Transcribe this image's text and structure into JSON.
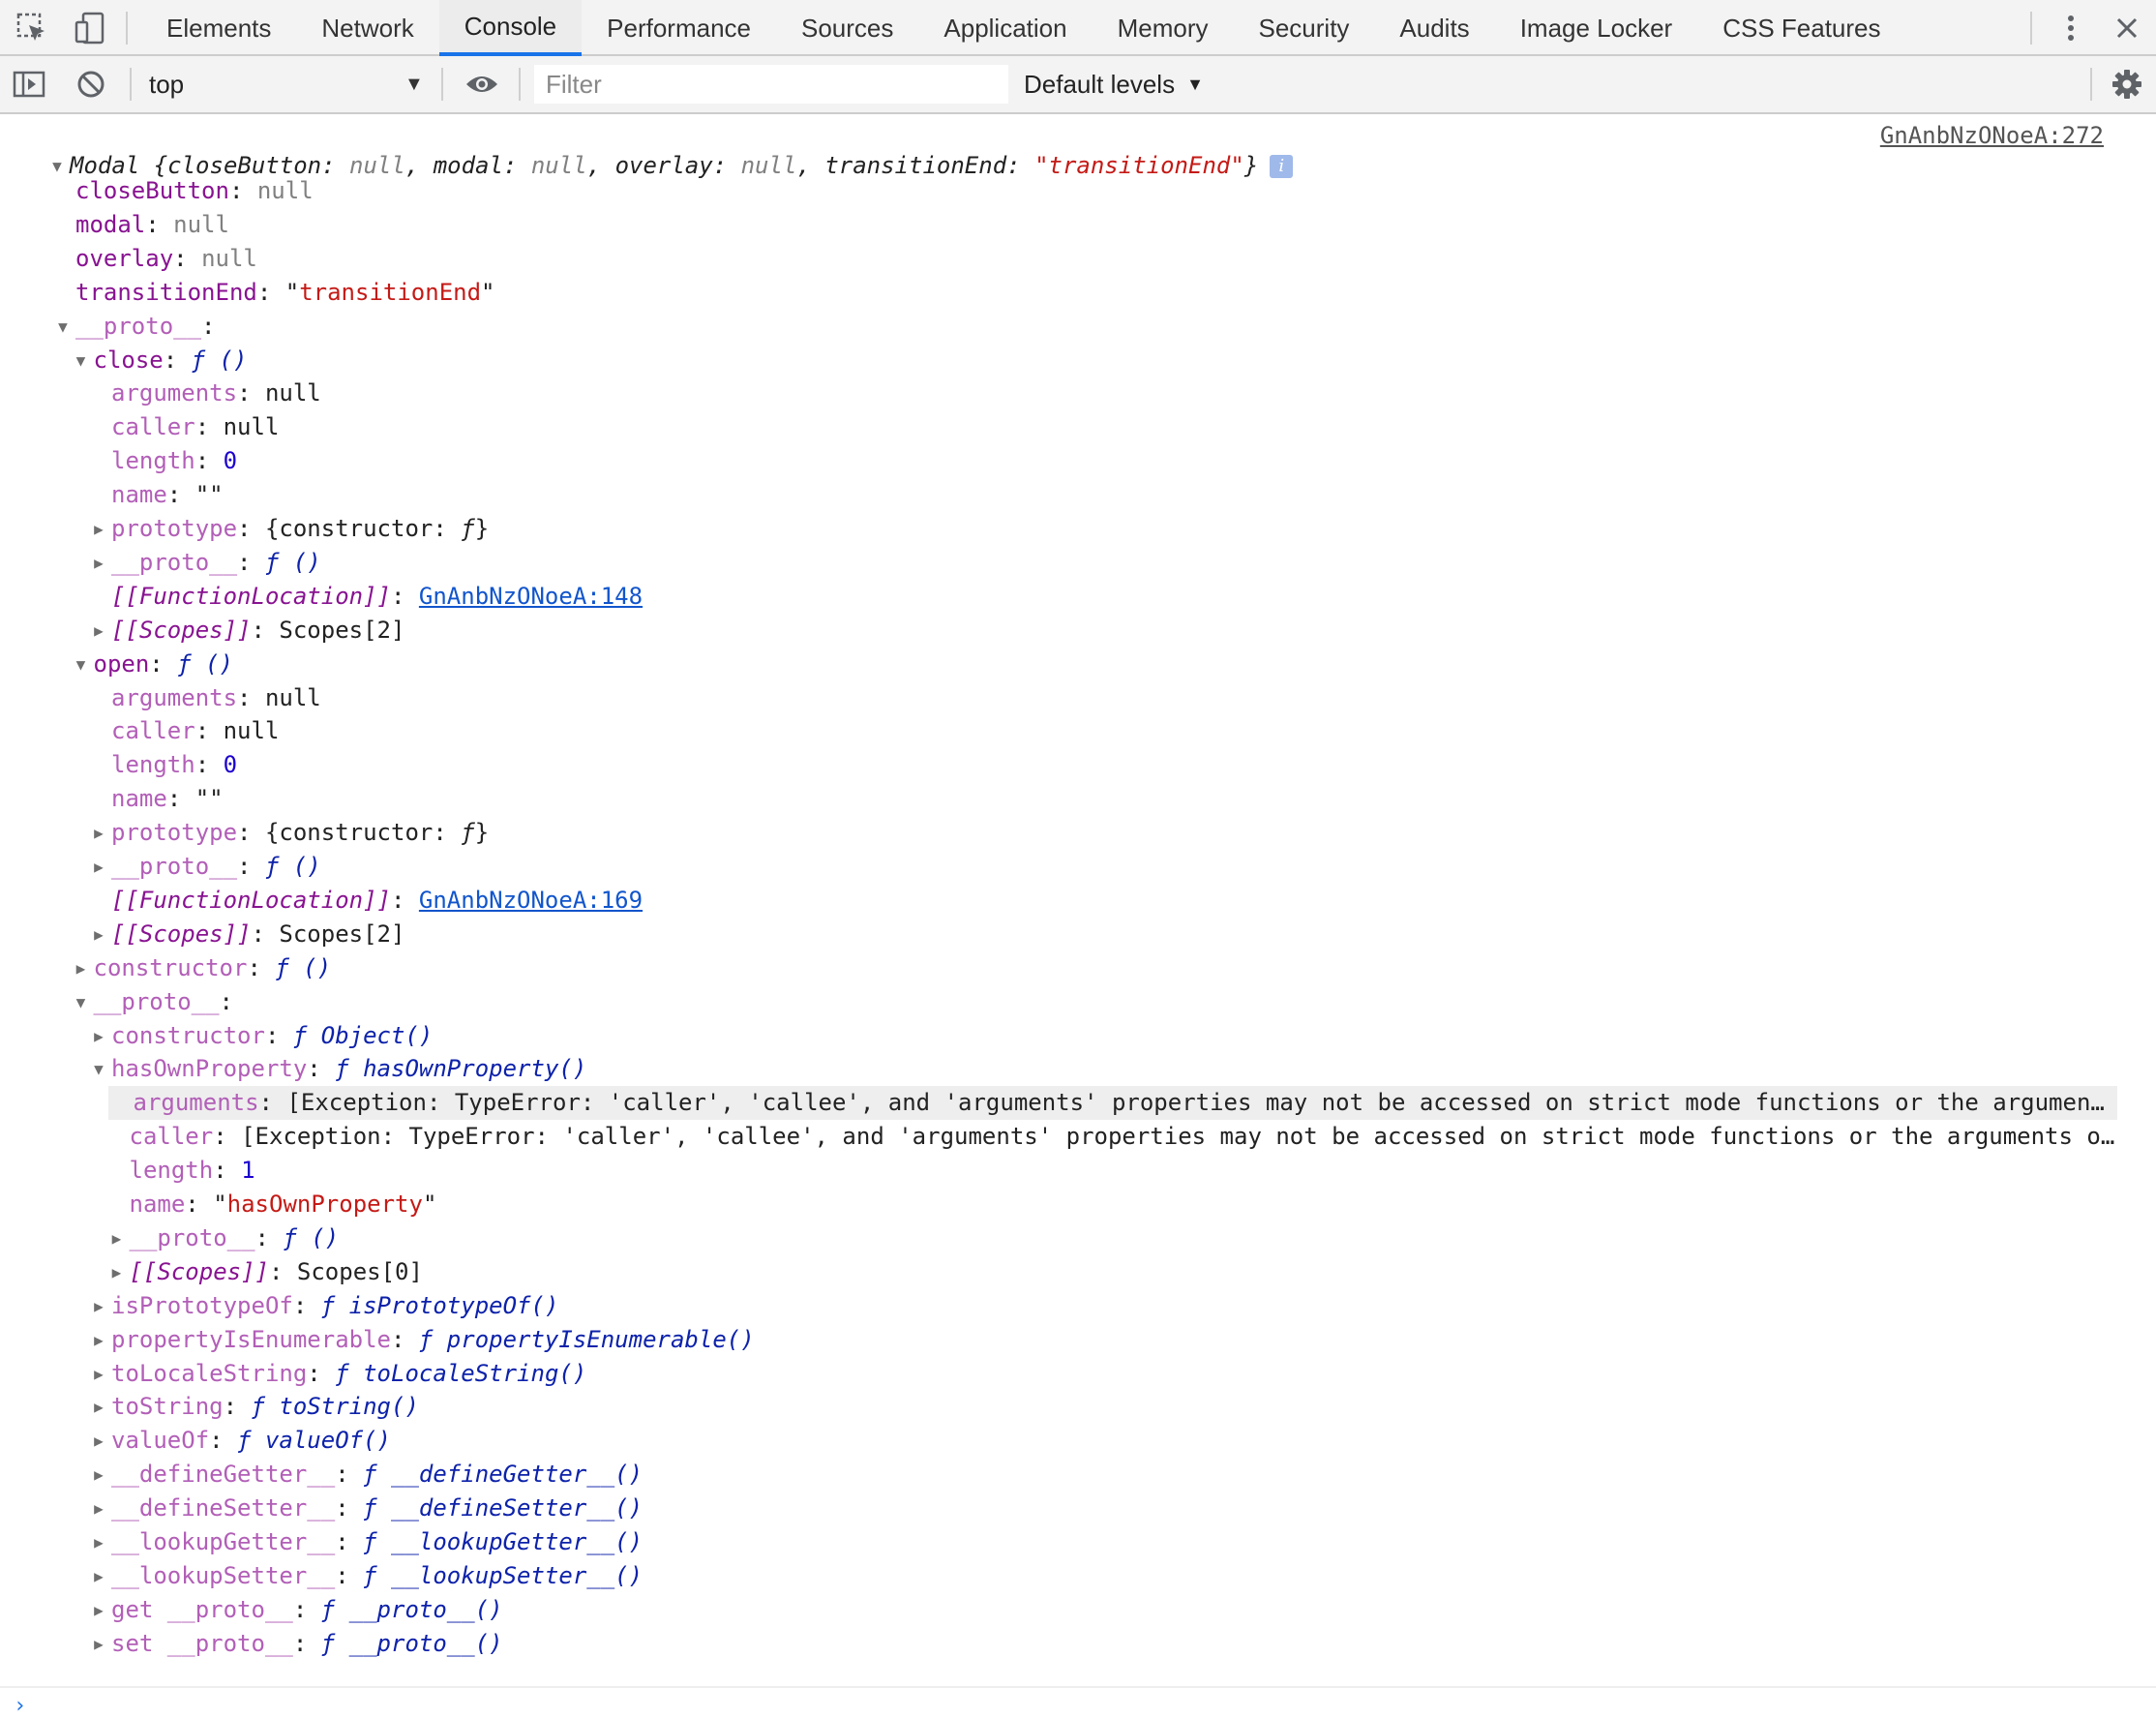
{
  "tabbar": {
    "icons": [
      "inspect-element-icon",
      "device-toolbar-icon"
    ],
    "tabs": [
      "Elements",
      "Network",
      "Console",
      "Performance",
      "Sources",
      "Application",
      "Memory",
      "Security",
      "Audits",
      "Image Locker",
      "CSS Features"
    ],
    "active_tab": "Console",
    "more_icon": "vertical-ellipsis-icon",
    "close_icon": "close-icon"
  },
  "toolbar": {
    "sidebar_icon": "show-sidebar-icon",
    "clear_icon": "clear-console-icon",
    "context": "top",
    "eye_icon": "live-expression-icon",
    "filter_placeholder": "Filter",
    "levels": "Default levels",
    "settings_icon": "gear-icon"
  },
  "console": {
    "source": "GnAnbNzONoeA:272",
    "modal_title": "Modal",
    "modal_summary_props": [
      {
        "k": "closeButton",
        "v": "null",
        "t": "null"
      },
      {
        "k": "modal",
        "v": "null",
        "t": "null"
      },
      {
        "k": "overlay",
        "v": "null",
        "t": "null"
      },
      {
        "k": "transitionEnd",
        "v": "\"transitionEnd\"",
        "t": "str"
      }
    ],
    "lines": [
      {
        "d": 1,
        "tri": "",
        "kc": "k",
        "key": "closeButton",
        "vals": [
          {
            "c": "null",
            "t": "null"
          }
        ]
      },
      {
        "d": 1,
        "tri": "",
        "kc": "k",
        "key": "modal",
        "vals": [
          {
            "c": "null",
            "t": "null"
          }
        ]
      },
      {
        "d": 1,
        "tri": "",
        "kc": "k",
        "key": "overlay",
        "vals": [
          {
            "c": "null",
            "t": "null"
          }
        ]
      },
      {
        "d": 1,
        "tri": "",
        "kc": "k",
        "key": "transitionEnd",
        "vals": [
          {
            "c": "plain",
            "t": "\""
          },
          {
            "c": "str",
            "t": "transitionEnd"
          },
          {
            "c": "plain",
            "t": "\""
          }
        ]
      },
      {
        "d": 1,
        "tri": "open",
        "kc": "k dim",
        "key": "__proto__",
        "vals": []
      },
      {
        "d": 2,
        "tri": "open",
        "kc": "k",
        "key": "close",
        "vals": [
          {
            "c": "fn",
            "t": "ƒ ()"
          }
        ]
      },
      {
        "d": 3,
        "tri": "",
        "kc": "k dim",
        "key": "arguments",
        "vals": [
          {
            "c": "plain",
            "t": "null"
          }
        ]
      },
      {
        "d": 3,
        "tri": "",
        "kc": "k dim",
        "key": "caller",
        "vals": [
          {
            "c": "plain",
            "t": "null"
          }
        ]
      },
      {
        "d": 3,
        "tri": "",
        "kc": "k dim",
        "key": "length",
        "vals": [
          {
            "c": "num",
            "t": "0"
          }
        ]
      },
      {
        "d": 3,
        "tri": "",
        "kc": "k dim",
        "key": "name",
        "vals": [
          {
            "c": "plain",
            "t": "\"\""
          }
        ]
      },
      {
        "d": 3,
        "tri": "closed",
        "kc": "k dim",
        "key": "prototype",
        "vals": [
          {
            "c": "plain",
            "t": "{constructor: "
          },
          {
            "c": "it",
            "t": "ƒ"
          },
          {
            "c": "plain",
            "t": "}"
          }
        ]
      },
      {
        "d": 3,
        "tri": "closed",
        "kc": "k dim",
        "key": "__proto__",
        "vals": [
          {
            "c": "fn",
            "t": "ƒ ()"
          }
        ]
      },
      {
        "d": 3,
        "tri": "",
        "kc": "k int",
        "key": "[[FunctionLocation]]",
        "vals": [
          {
            "c": "link",
            "t": "GnAnbNzONoeA:148"
          }
        ]
      },
      {
        "d": 3,
        "tri": "closed",
        "kc": "k int",
        "key": "[[Scopes]]",
        "vals": [
          {
            "c": "plain",
            "t": "Scopes[2]"
          }
        ]
      },
      {
        "d": 2,
        "tri": "open",
        "kc": "k",
        "key": "open",
        "vals": [
          {
            "c": "fn",
            "t": "ƒ ()"
          }
        ]
      },
      {
        "d": 3,
        "tri": "",
        "kc": "k dim",
        "key": "arguments",
        "vals": [
          {
            "c": "plain",
            "t": "null"
          }
        ]
      },
      {
        "d": 3,
        "tri": "",
        "kc": "k dim",
        "key": "caller",
        "vals": [
          {
            "c": "plain",
            "t": "null"
          }
        ]
      },
      {
        "d": 3,
        "tri": "",
        "kc": "k dim",
        "key": "length",
        "vals": [
          {
            "c": "num",
            "t": "0"
          }
        ]
      },
      {
        "d": 3,
        "tri": "",
        "kc": "k dim",
        "key": "name",
        "vals": [
          {
            "c": "plain",
            "t": "\"\""
          }
        ]
      },
      {
        "d": 3,
        "tri": "closed",
        "kc": "k dim",
        "key": "prototype",
        "vals": [
          {
            "c": "plain",
            "t": "{constructor: "
          },
          {
            "c": "it",
            "t": "ƒ"
          },
          {
            "c": "plain",
            "t": "}"
          }
        ]
      },
      {
        "d": 3,
        "tri": "closed",
        "kc": "k dim",
        "key": "__proto__",
        "vals": [
          {
            "c": "fn",
            "t": "ƒ ()"
          }
        ]
      },
      {
        "d": 3,
        "tri": "",
        "kc": "k int",
        "key": "[[FunctionLocation]]",
        "vals": [
          {
            "c": "link",
            "t": "GnAnbNzONoeA:169"
          }
        ]
      },
      {
        "d": 3,
        "tri": "closed",
        "kc": "k int",
        "key": "[[Scopes]]",
        "vals": [
          {
            "c": "plain",
            "t": "Scopes[2]"
          }
        ]
      },
      {
        "d": 2,
        "tri": "closed",
        "kc": "k dim",
        "key": "constructor",
        "vals": [
          {
            "c": "fn",
            "t": "ƒ ()"
          }
        ]
      },
      {
        "d": 2,
        "tri": "open",
        "kc": "k dim",
        "key": "__proto__",
        "vals": []
      },
      {
        "d": 3,
        "tri": "closed",
        "kc": "k dim",
        "key": "constructor",
        "vals": [
          {
            "c": "fn",
            "t": "ƒ Object()"
          }
        ]
      },
      {
        "d": 3,
        "tri": "open",
        "kc": "k dim",
        "key": "hasOwnProperty",
        "vals": [
          {
            "c": "fn",
            "t": "ƒ hasOwnProperty()"
          }
        ]
      },
      {
        "d": 4,
        "tri": "",
        "kc": "k dim",
        "key": "arguments",
        "hl": true,
        "vals": [
          {
            "c": "plain",
            "t": "[Exception: TypeError: 'caller', 'callee', and 'arguments' properties may not be accessed on strict mode functions or the arguments objects for calls to them at Function.invokeGetter"
          }
        ]
      },
      {
        "d": 4,
        "tri": "",
        "kc": "k dim",
        "key": "caller",
        "vals": [
          {
            "c": "plain",
            "t": "[Exception: TypeError: 'caller', 'callee', and 'arguments' properties may not be accessed on strict mode functions or the arguments objects for calls to them at Function.invokeGetter"
          }
        ]
      },
      {
        "d": 4,
        "tri": "",
        "kc": "k dim",
        "key": "length",
        "vals": [
          {
            "c": "num",
            "t": "1"
          }
        ]
      },
      {
        "d": 4,
        "tri": "",
        "kc": "k dim",
        "key": "name",
        "vals": [
          {
            "c": "plain",
            "t": "\""
          },
          {
            "c": "str",
            "t": "hasOwnProperty"
          },
          {
            "c": "plain",
            "t": "\""
          }
        ]
      },
      {
        "d": 4,
        "tri": "closed",
        "kc": "k dim",
        "key": "__proto__",
        "vals": [
          {
            "c": "fn",
            "t": "ƒ ()"
          }
        ]
      },
      {
        "d": 4,
        "tri": "closed",
        "kc": "k int",
        "key": "[[Scopes]]",
        "vals": [
          {
            "c": "plain",
            "t": "Scopes[0]"
          }
        ]
      },
      {
        "d": 3,
        "tri": "closed",
        "kc": "k dim",
        "key": "isPrototypeOf",
        "vals": [
          {
            "c": "fn",
            "t": "ƒ isPrototypeOf()"
          }
        ]
      },
      {
        "d": 3,
        "tri": "closed",
        "kc": "k dim",
        "key": "propertyIsEnumerable",
        "vals": [
          {
            "c": "fn",
            "t": "ƒ propertyIsEnumerable()"
          }
        ]
      },
      {
        "d": 3,
        "tri": "closed",
        "kc": "k dim",
        "key": "toLocaleString",
        "vals": [
          {
            "c": "fn",
            "t": "ƒ toLocaleString()"
          }
        ]
      },
      {
        "d": 3,
        "tri": "closed",
        "kc": "k dim",
        "key": "toString",
        "vals": [
          {
            "c": "fn",
            "t": "ƒ toString()"
          }
        ]
      },
      {
        "d": 3,
        "tri": "closed",
        "kc": "k dim",
        "key": "valueOf",
        "vals": [
          {
            "c": "fn",
            "t": "ƒ valueOf()"
          }
        ]
      },
      {
        "d": 3,
        "tri": "closed",
        "kc": "k dim",
        "key": "__defineGetter__",
        "vals": [
          {
            "c": "fn",
            "t": "ƒ __defineGetter__()"
          }
        ]
      },
      {
        "d": 3,
        "tri": "closed",
        "kc": "k dim",
        "key": "__defineSetter__",
        "vals": [
          {
            "c": "fn",
            "t": "ƒ __defineSetter__()"
          }
        ]
      },
      {
        "d": 3,
        "tri": "closed",
        "kc": "k dim",
        "key": "__lookupGetter__",
        "vals": [
          {
            "c": "fn",
            "t": "ƒ __lookupGetter__()"
          }
        ]
      },
      {
        "d": 3,
        "tri": "closed",
        "kc": "k dim",
        "key": "__lookupSetter__",
        "vals": [
          {
            "c": "fn",
            "t": "ƒ __lookupSetter__()"
          }
        ]
      },
      {
        "d": 3,
        "tri": "closed",
        "kc": "k dim",
        "key": "get __proto__",
        "vals": [
          {
            "c": "fn",
            "t": "ƒ __proto__()"
          }
        ]
      },
      {
        "d": 3,
        "tri": "closed",
        "kc": "k dim",
        "key": "set __proto__",
        "vals": [
          {
            "c": "fn",
            "t": "ƒ __proto__()"
          }
        ]
      }
    ],
    "prompt": "›"
  }
}
